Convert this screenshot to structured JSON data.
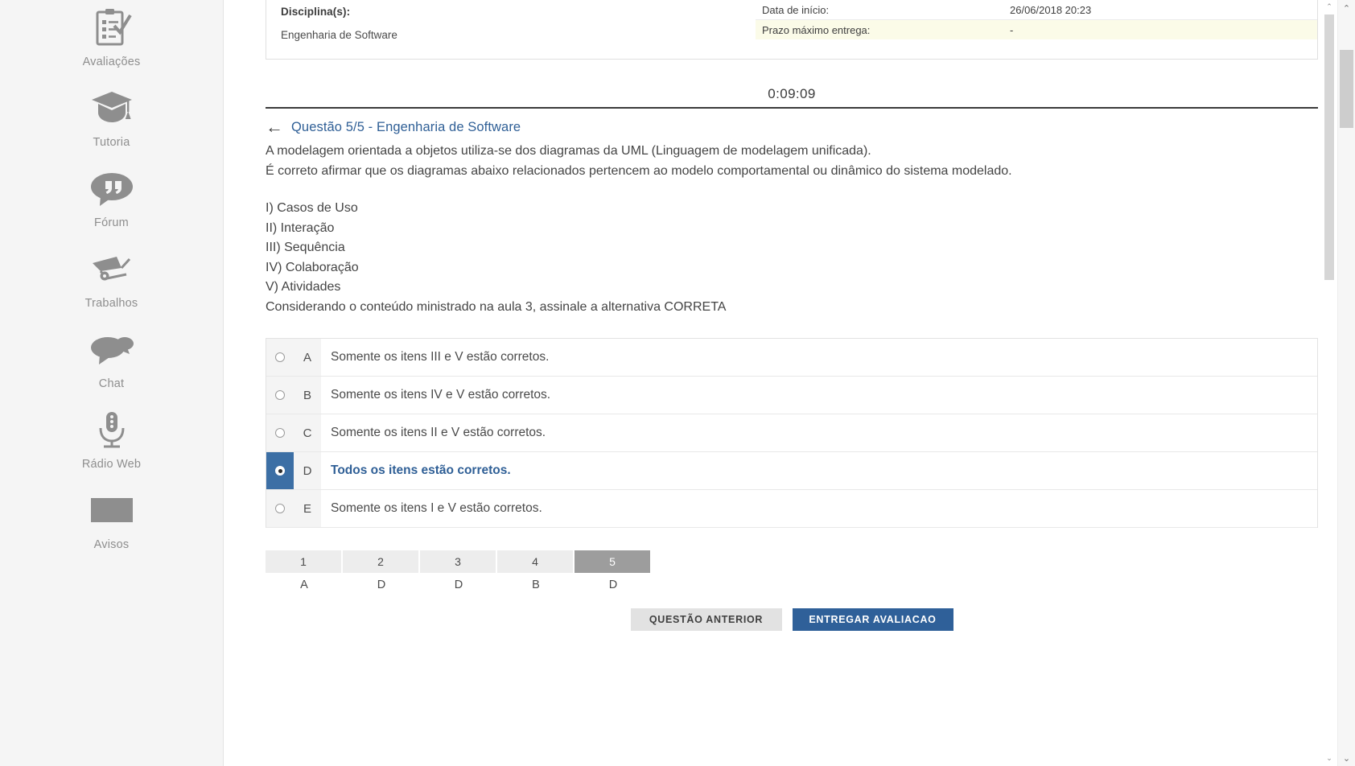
{
  "sidebar": {
    "items": [
      {
        "label": "Avaliações",
        "icon": "clipboard-check-icon"
      },
      {
        "label": "Tutoria",
        "icon": "graduation-cap-icon"
      },
      {
        "label": "Fórum",
        "icon": "quote-bubble-icon"
      },
      {
        "label": "Trabalhos",
        "icon": "wheelbarrow-icon"
      },
      {
        "label": "Chat",
        "icon": "chat-bubbles-icon"
      },
      {
        "label": "Rádio Web",
        "icon": "microphone-icon"
      },
      {
        "label": "Avisos",
        "icon": "envelope-icon"
      }
    ]
  },
  "info_panel": {
    "discipline_label": "Disciplina(s):",
    "discipline_value": "Engenharia de Software",
    "rows": [
      {
        "key": "Data de início:",
        "value": "26/06/2018 20:23"
      },
      {
        "key": "Prazo máximo entrega:",
        "value": "-"
      }
    ]
  },
  "timer": {
    "value": "0:09:09"
  },
  "question": {
    "back_arrow": "←",
    "title": "Questão 5/5 - Engenharia de Software",
    "paragraph_1": "A modelagem orientada a objetos utiliza-se dos diagramas da UML (Linguagem de modelagem unificada).",
    "paragraph_2": "É correto afirmar que os diagramas abaixo relacionados pertencem ao modelo comportamental ou dinâmico do sistema modelado.",
    "items": [
      "I) Casos de Uso",
      "II) Interação",
      "III) Sequência",
      "IV) Colaboração",
      "V) Atividades"
    ],
    "instruction": "Considerando o conteúdo ministrado na aula 3, assinale a alternativa CORRETA",
    "options": [
      {
        "letter": "A",
        "text": "Somente os itens III e V estão corretos.",
        "selected": false
      },
      {
        "letter": "B",
        "text": "Somente os itens IV e V estão corretos.",
        "selected": false
      },
      {
        "letter": "C",
        "text": "Somente os itens II e V estão corretos.",
        "selected": false
      },
      {
        "letter": "D",
        "text": "Todos os itens estão corretos.",
        "selected": true
      },
      {
        "letter": "E",
        "text": "Somente os itens I e V estão corretos.",
        "selected": false
      }
    ]
  },
  "question_nav": {
    "cells": [
      {
        "number": "1",
        "answer": "A",
        "active": false
      },
      {
        "number": "2",
        "answer": "D",
        "active": false
      },
      {
        "number": "3",
        "answer": "D",
        "active": false
      },
      {
        "number": "4",
        "answer": "B",
        "active": false
      },
      {
        "number": "5",
        "answer": "D",
        "active": true
      }
    ]
  },
  "buttons": {
    "previous": "QUESTÃO ANTERIOR",
    "submit": "ENTREGAR AVALIACAO"
  },
  "scrollbar": {
    "up_arrow": "⌃",
    "down_arrow": "⌄"
  },
  "colors": {
    "accent_blue": "#2f6099",
    "selected_blue": "#3c6fa5",
    "sidebar_bg": "#f5f5f5",
    "highlight_row": "#fbfbe8",
    "active_nav": "#9d9d9d"
  }
}
